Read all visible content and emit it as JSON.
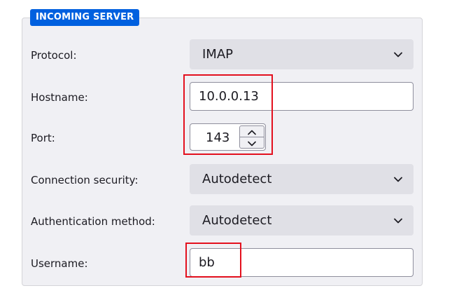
{
  "incoming_server": {
    "legend": "INCOMING SERVER",
    "protocol": {
      "label": "Protocol:",
      "value": "IMAP"
    },
    "hostname": {
      "label": "Hostname:",
      "value": "10.0.0.13"
    },
    "port": {
      "label": "Port:",
      "value": "143"
    },
    "connection_security": {
      "label": "Connection security:",
      "value": "Autodetect"
    },
    "authentication_method": {
      "label": "Authentication method:",
      "value": "Autodetect"
    },
    "username": {
      "label": "Username:",
      "value": "bb"
    }
  },
  "icons": {
    "dropdown": "chevron-down-icon",
    "spin_up": "chevron-up-icon",
    "spin_down": "chevron-down-icon"
  },
  "colors": {
    "legend_bg": "#0060df",
    "highlight": "#e3101e",
    "panel_bg": "#f0f0f4",
    "select_bg": "#e0e0e6"
  }
}
